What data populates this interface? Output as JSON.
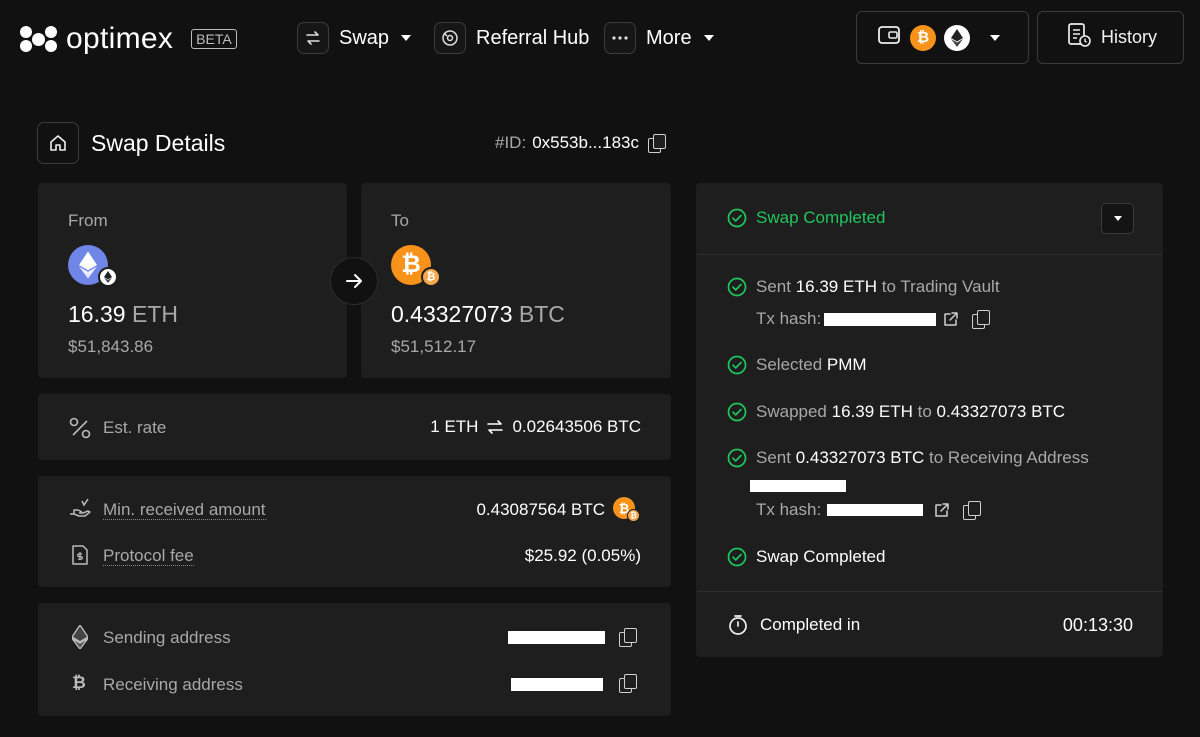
{
  "header": {
    "logo_text": "optimex",
    "beta_badge": "BETA",
    "nav": [
      {
        "label": "Swap",
        "icon": "swap-arrows-icon",
        "has_dropdown": true
      },
      {
        "label": "Referral Hub",
        "icon": "referral-icon",
        "has_dropdown": false
      },
      {
        "label": "More",
        "icon": "dots-icon",
        "has_dropdown": true
      }
    ],
    "wallet_icons": [
      "wallet-icon",
      "bitcoin-icon",
      "ethereum-icon"
    ],
    "history_label": "History"
  },
  "page": {
    "title": "Swap Details",
    "id_label": "#ID:",
    "id_value": "0x553b...183c"
  },
  "from": {
    "label": "From",
    "amount": "16.39",
    "symbol": "ETH",
    "usd": "$51,843.86"
  },
  "to": {
    "label": "To",
    "amount": "0.43327073",
    "symbol": "BTC",
    "usd": "$51,512.17"
  },
  "rate": {
    "label": "Est. rate",
    "left": "1 ETH",
    "right": "0.02643506 BTC"
  },
  "amounts": {
    "min_label": "Min. received amount",
    "min_value": "0.43087564 BTC",
    "fee_label": "Protocol fee",
    "fee_value": "$25.92 (0.05%)"
  },
  "addresses": {
    "sending_label": "Sending address",
    "receiving_label": "Receiving address"
  },
  "status": {
    "title": "Swap Completed",
    "steps": {
      "s1_pre": "Sent",
      "s1_amount": "16.39 ETH",
      "s1_mid": "to",
      "s1_dest": "Trading Vault",
      "tx_label": "Tx hash:",
      "s2_pre": "Selected",
      "s2_val": "PMM",
      "s3_pre": "Swapped",
      "s3_a": "16.39 ETH",
      "s3_mid": "to",
      "s3_b": "0.43327073 BTC",
      "s4_pre": "Sent",
      "s4_amount": "0.43327073 BTC",
      "s4_mid": "to",
      "s4_dest": "Receiving Address",
      "s5": "Swap Completed"
    },
    "completed_label": "Completed in",
    "completed_time": "00:13:30"
  },
  "colors": {
    "success": "#21c55d",
    "bitcoin": "#f7931a",
    "ethereum": "#6f86e6",
    "background": "#111111",
    "card": "#1e1e1e"
  }
}
